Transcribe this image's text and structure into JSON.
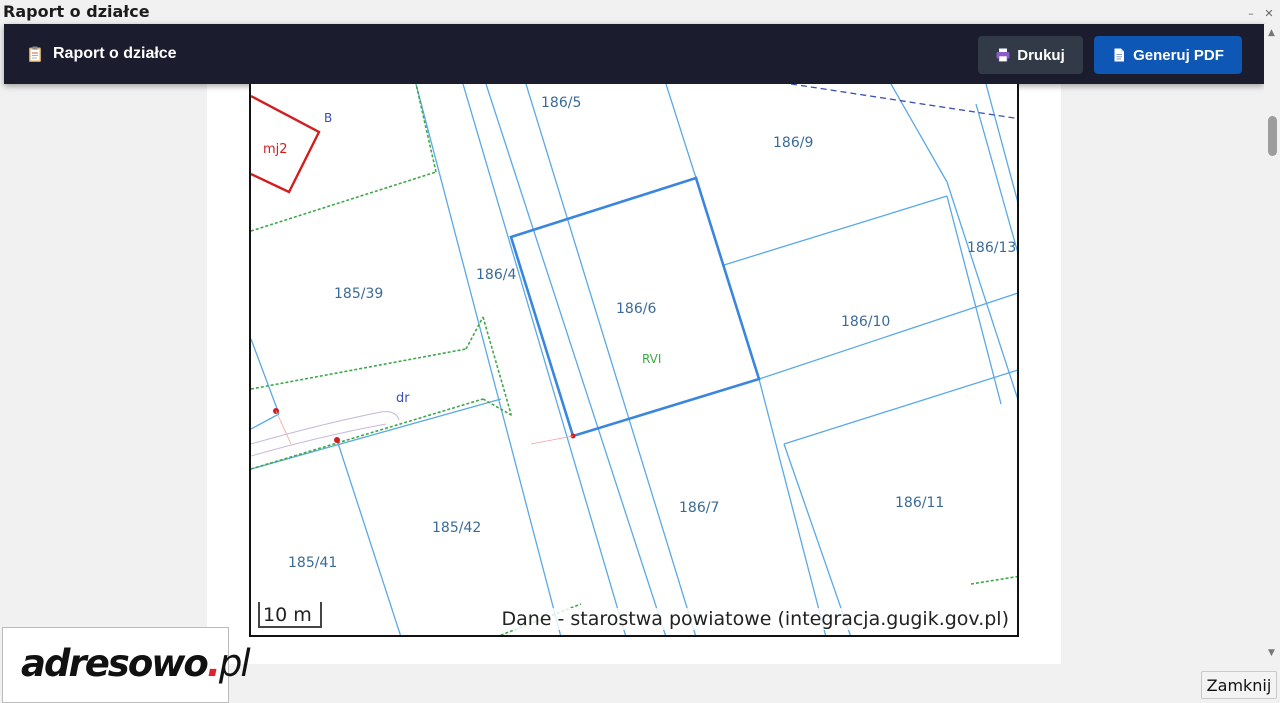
{
  "window": {
    "title": "Raport o działce",
    "minimize_glyph": "–",
    "close_glyph": "✕"
  },
  "toolbar": {
    "title": "Raport o działce",
    "print_label": "Drukuj",
    "pdf_label": "Generuj PDF",
    "report_icon": "clipboard-icon",
    "print_icon": "printer-icon",
    "pdf_icon": "document-icon"
  },
  "map": {
    "parcels": {
      "p186_5": "186/5",
      "p186_9": "186/9",
      "p186_13": "186/13",
      "p185_39": "185/39",
      "p186_4": "186/4",
      "p186_6": "186/6",
      "p186_10": "186/10",
      "p186_7": "186/7",
      "p186_11": "186/11",
      "p185_42": "185/42",
      "p185_41": "185/41"
    },
    "labels": {
      "mj2": "mj2",
      "b": "B",
      "dr": "dr",
      "rvi": "RVI"
    },
    "scale": "10 m",
    "attribution": "Dane - starostwa powiatowe (integracja.gugik.gov.pl)",
    "colors": {
      "parcel_line": "#5aa9e6",
      "selected_parcel": "#3a86df",
      "building": "#d11f1f",
      "label": "#3b6b96",
      "land_class": "#3fa84a"
    }
  },
  "logo": {
    "brand": "adresowo",
    "dot": ".",
    "tld": "pl"
  },
  "footer": {
    "close_label": "Zamknij"
  }
}
